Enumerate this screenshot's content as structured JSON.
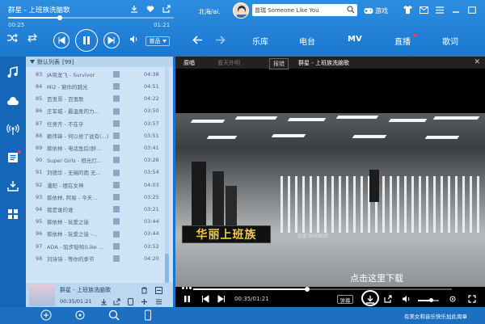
{
  "app": {
    "accent": "#1a78cf"
  },
  "player": {
    "song_title": "群星 - 上班族洗脑歌",
    "current_time": "00:25",
    "duration": "01:21",
    "progress": 0.31,
    "quality": "普品"
  },
  "account": {
    "user": "北海/ai.",
    "search_placeholder": "曾瑞 Someone Like You",
    "game_label": "游戏"
  },
  "nav": {
    "tabs": [
      "乐库",
      "电台",
      "MV",
      "直播",
      "歌词"
    ],
    "active": "MV"
  },
  "playlist": {
    "header": "默认列表",
    "count": "[99]",
    "rows": [
      {
        "num": "83",
        "name": "JA将龙飞 - Survivor",
        "dur": "04:38"
      },
      {
        "num": "84",
        "name": "Mi2 - 窗你的跳光",
        "dur": "04:51"
      },
      {
        "num": "85",
        "name": "百鬼哥 - 百鬼歌",
        "dur": "04:22"
      },
      {
        "num": "86",
        "name": "庄军城 - 最温柔的力...",
        "dur": "03:50"
      },
      {
        "num": "87",
        "name": "任贤齐 - 不在乎",
        "dur": "03:57"
      },
      {
        "num": "88",
        "name": "赖伟锋 - 何以修了说有(...)",
        "dur": "03:51"
      },
      {
        "num": "89",
        "name": "蔡依林 - 电话鱼后(醉...",
        "dur": "03:41"
      },
      {
        "num": "90",
        "name": "Super Girls - 棋光灯...",
        "dur": "03:26"
      },
      {
        "num": "91",
        "name": "刘德华 - 无锡的雨 无...",
        "dur": "03:54"
      },
      {
        "num": "92",
        "name": "潘阳 - 摆在女神",
        "dur": "04:03"
      },
      {
        "num": "93",
        "name": "蔡依林, 阿易 - 今天...",
        "dur": "03:25"
      },
      {
        "num": "94",
        "name": "我是谁的谁",
        "dur": "03:21"
      },
      {
        "num": "95",
        "name": "蔡依林 - 玩爱之徒",
        "dur": "03:44"
      },
      {
        "num": "96",
        "name": "蔡依林 - 玩爱之徒 -...",
        "dur": "03:44"
      },
      {
        "num": "97",
        "name": "ADA - 陷步轻啃(Like ...",
        "dur": "03:52"
      },
      {
        "num": "98",
        "name": "刘诗诗 - 等你的季节",
        "dur": "04:20"
      }
    ]
  },
  "mini": {
    "title": "群星 - 上班族洗脑歌",
    "time": "00:35/01:21"
  },
  "mv": {
    "tabs": [
      "原唱",
      "看天外明",
      "报错"
    ],
    "title": "群星 - 上班族洗脑歌",
    "caption": "华丽上班族",
    "watermark": "艺鉴 音画频道",
    "hint": "点击这里下载",
    "time": "00:35/01:21",
    "progress": 0.44,
    "danmu": "弹幕"
  },
  "bottom": {
    "right_text": "有美女和音乐快乐加此周章"
  }
}
